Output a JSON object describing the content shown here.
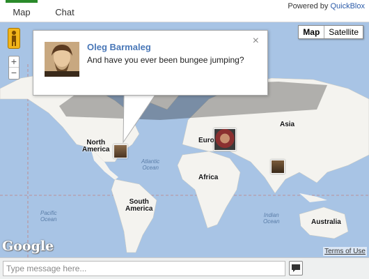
{
  "tabs": [
    {
      "label": "Map",
      "active": true
    },
    {
      "label": "Chat",
      "active": false
    }
  ],
  "powered_by": {
    "prefix": "Powered by",
    "link": "QuickBlox"
  },
  "map": {
    "type_buttons": {
      "map": "Map",
      "satellite": "Satellite"
    },
    "zoom_in": "+",
    "zoom_out": "−",
    "labels": {
      "north_america": "North\nAmerica",
      "south_america": "South\nAmerica",
      "europe": "Euro",
      "asia": "Asia",
      "africa": "Africa",
      "australia": "Australia"
    },
    "oceans": {
      "atlantic": "Atlantic\nOcean",
      "pacific": "Pacific\nOcean",
      "indian": "Indian\nOcean"
    },
    "logo": "Google",
    "terms": "Terms of Use"
  },
  "popup": {
    "user_name": "Oleg Barmaleg",
    "message": "And have you ever been bungee jumping?",
    "close": "×"
  },
  "input": {
    "placeholder": "Type message here...",
    "value": ""
  },
  "colors": {
    "accent_tab": "#2a8a2a",
    "link": "#2a5aa8",
    "user_name": "#4a78b8",
    "ocean": "#a8c4e5",
    "land": "#f4f3ef"
  }
}
